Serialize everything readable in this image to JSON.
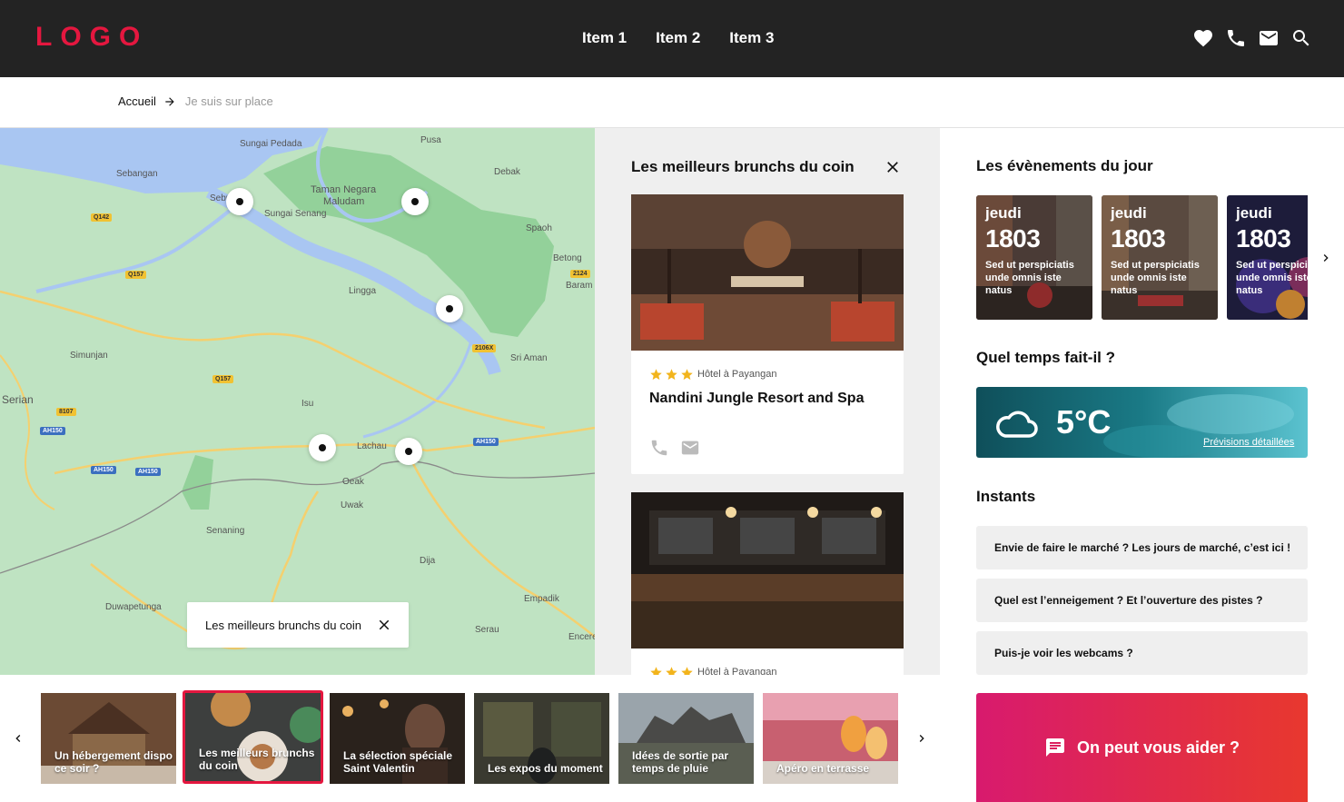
{
  "header": {
    "logo": "LOGO",
    "nav": [
      "Item 1",
      "Item 2",
      "Item 3"
    ],
    "colors": {
      "background": "#232323",
      "logo": "#e4173f"
    }
  },
  "breadcrumb": {
    "home": "Accueil",
    "current": "Je suis sur place"
  },
  "map": {
    "labels": [
      "Sungai Pedada",
      "Pusa",
      "Sebangan",
      "Sebuyau",
      "Taman Negara",
      "Maludam",
      "Sungai Senang",
      "Debak",
      "Spaoh",
      "Betong",
      "Baram",
      "Lingga",
      "Simunjan",
      "Sri Aman",
      "Serian",
      "Isu",
      "Lachau",
      "Oeak",
      "Uwak",
      "Senaning",
      "Dija",
      "Duwapetunga",
      "Empadik",
      "Serau",
      "Encerey"
    ],
    "road_badges": [
      "Q142",
      "Q157",
      "2124",
      "2106X",
      "Q157",
      "8107",
      "AH150",
      "AH150",
      "AH150",
      "AH150"
    ],
    "chip": {
      "label": "Les meilleurs brunchs du coin"
    }
  },
  "panel": {
    "title": "Les meilleurs brunchs du coin",
    "cards": [
      {
        "stars": 3,
        "category": "Hôtel à Payangan",
        "name": "Nandini Jungle Resort and Spa"
      },
      {
        "stars": 3,
        "category": "Hôtel à Payangan",
        "name": ""
      }
    ]
  },
  "events": {
    "title": "Les évènements du jour",
    "items": [
      {
        "day": "jeudi",
        "date": "1803",
        "text": "Sed ut perspiciatis unde omnis iste natus"
      },
      {
        "day": "jeudi",
        "date": "1803",
        "text": "Sed ut perspiciatis unde omnis iste natus"
      },
      {
        "day": "jeudi",
        "date": "1803",
        "text": "Sed ut perspiciatis unde omnis iste natus"
      }
    ]
  },
  "weather": {
    "title": "Quel temps fait-il ?",
    "temperature": "5°C",
    "link": "Prévisions détaillées",
    "icon": "cloud-icon"
  },
  "instants": {
    "title": "Instants",
    "items": [
      "Envie de faire le marché ? Les jours de marché, c’est ici !",
      "Quel est l’enneigement ? Et l’ouverture des pistes ?",
      "Puis-je voir les webcams ?"
    ]
  },
  "help": {
    "label": "On peut vous aider ?",
    "icon": "chat-icon"
  },
  "carousel": {
    "active_index": 1,
    "items": [
      {
        "label": "Un hébergement dispo ce soir ?"
      },
      {
        "label": "Les meilleurs brunchs du coin"
      },
      {
        "label": "La sélection spéciale Saint Valentin"
      },
      {
        "label": "Les expos du moment"
      },
      {
        "label": "Idées de sortie par temps de pluie"
      },
      {
        "label": "Apéro en terrasse"
      }
    ]
  }
}
